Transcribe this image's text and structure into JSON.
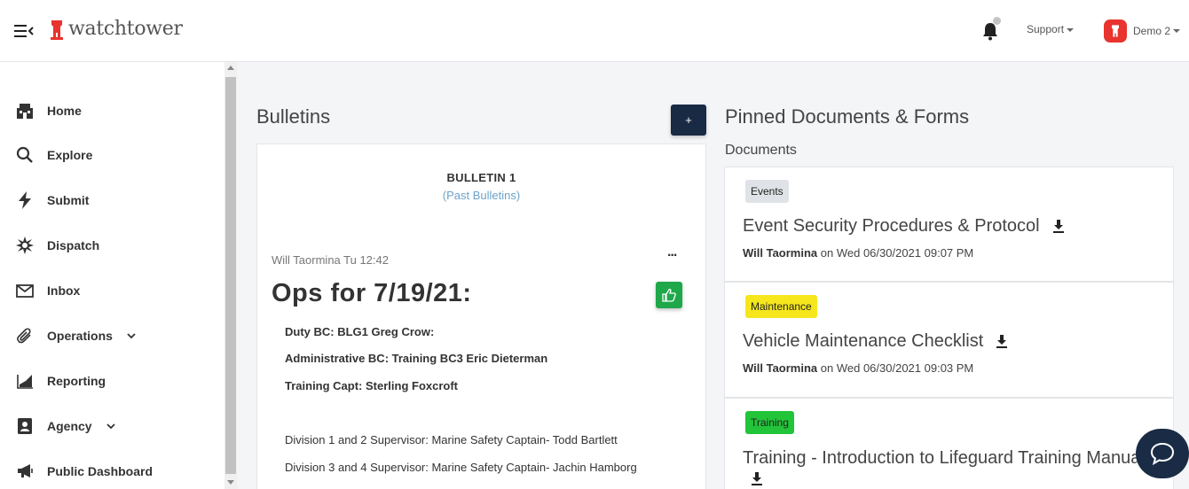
{
  "header": {
    "app_name": "watchtower",
    "support_label": "Support",
    "user_label": "Demo 2"
  },
  "sidebar": {
    "items": [
      {
        "label": "Home",
        "icon": "home-icon"
      },
      {
        "label": "Explore",
        "icon": "search-icon"
      },
      {
        "label": "Submit",
        "icon": "lightning-icon"
      },
      {
        "label": "Dispatch",
        "icon": "starburst-icon"
      },
      {
        "label": "Inbox",
        "icon": "envelope-icon"
      },
      {
        "label": "Operations",
        "icon": "paperclip-icon",
        "expandable": true
      },
      {
        "label": "Reporting",
        "icon": "area-chart-icon"
      },
      {
        "label": "Agency",
        "icon": "id-badge-icon",
        "expandable": true
      },
      {
        "label": "Public Dashboard",
        "icon": "megaphone-icon"
      }
    ]
  },
  "bulletins": {
    "section_title": "Bulletins",
    "add_label": "+",
    "heading": "BULLETIN 1",
    "past_link": "(Past Bulletins)",
    "author_line": "Will Taormina Tu 12:42",
    "more_label": "...",
    "title": "Ops for 7/19/21:",
    "lines": [
      "Duty BC: BLG1 Greg Crow:",
      "Administrative BC: Training BC3 Eric Dieterman",
      "Training Capt: Sterling Foxcroft",
      "Division 1 and 2 Supervisor: Marine Safety Captain-  Todd Bartlett",
      "Division 3 and 4 Supervisor: Marine Safety Captain-  Jachin Hamborg"
    ]
  },
  "pinned": {
    "section_title": "Pinned Documents & Forms",
    "subtitle": "Documents",
    "documents": [
      {
        "tag": "Events",
        "tag_color": "#dfe2e6",
        "title": "Event Security Procedures & Protocol",
        "author": "Will Taormina",
        "date_text": " on Wed 06/30/2021 09:07 PM"
      },
      {
        "tag": "Maintenance",
        "tag_color": "#f5e61d",
        "title": "Vehicle Maintenance Checklist",
        "author": "Will Taormina",
        "date_text": " on Wed 06/30/2021 09:03 PM"
      },
      {
        "tag": "Training",
        "tag_color": "#22c43a",
        "title": "Training - Introduction to Lifeguard Training Manual",
        "author": "",
        "date_text": ""
      }
    ]
  },
  "colors": {
    "accent_navy": "#182a44",
    "like_green": "#1ea84a",
    "logo_red": "#e8332e",
    "link_blue": "#6ca3c9"
  }
}
